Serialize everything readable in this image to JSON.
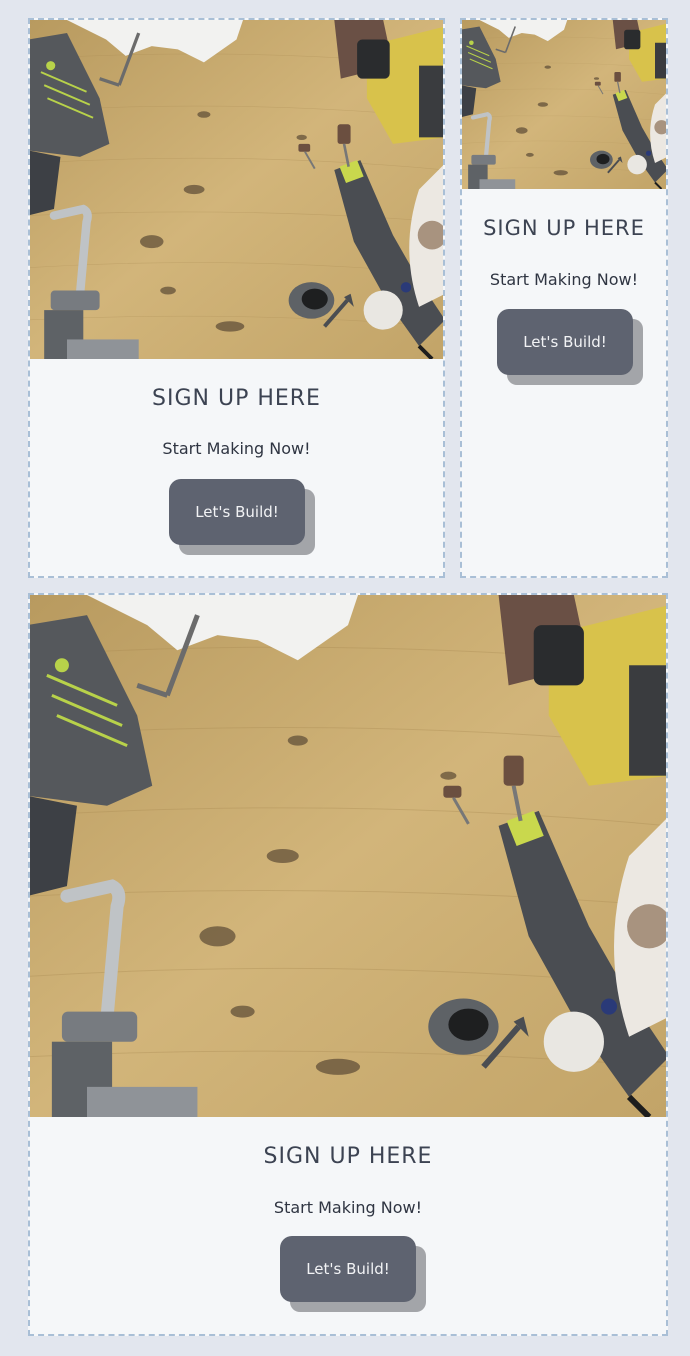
{
  "cards": [
    {
      "title": "SIGN UP HERE",
      "subtitle": "Start Making Now!",
      "button_label": "Let's Build!",
      "image_icon": "workbench-tools-image"
    },
    {
      "title": "SIGN UP HERE",
      "subtitle": "Start Making Now!",
      "button_label": "Let's Build!",
      "image_icon": "workbench-tools-image"
    },
    {
      "title": "SIGN UP HERE",
      "subtitle": "Start Making Now!",
      "button_label": "Let's Build!",
      "image_icon": "workbench-tools-image"
    }
  ],
  "colors": {
    "page_background": "#e2e6ee",
    "card_background": "#f5f7f9",
    "card_border": "#a9bfd6",
    "button": "#5e6370",
    "button_shadow": "#a3a5a9",
    "wood": "#c9a86a"
  }
}
